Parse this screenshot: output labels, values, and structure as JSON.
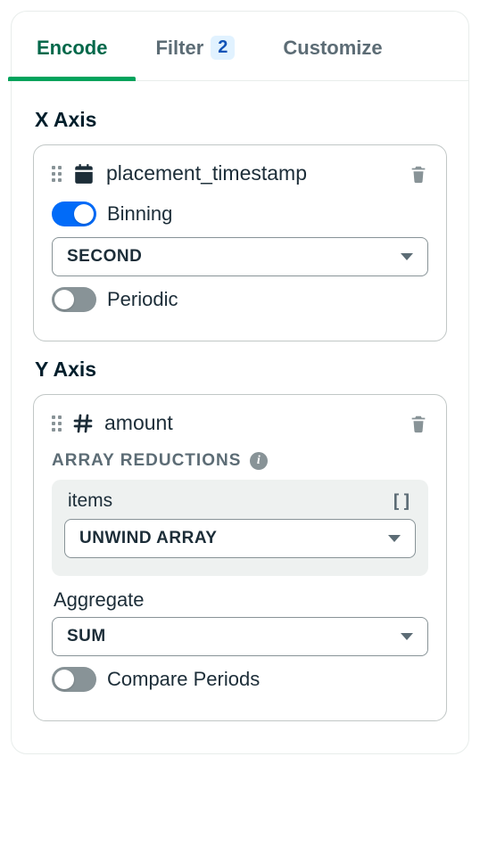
{
  "tabs": {
    "encode": "Encode",
    "filter": "Filter",
    "filter_count": "2",
    "customize": "Customize"
  },
  "xaxis": {
    "title": "X Axis",
    "field": "placement_timestamp",
    "binning_label": "Binning",
    "binning_select": "SECOND",
    "periodic_label": "Periodic"
  },
  "yaxis": {
    "title": "Y Axis",
    "field": "amount",
    "reductions_header": "ARRAY REDUCTIONS",
    "reduction_field": "items",
    "reduction_select": "UNWIND ARRAY",
    "aggregate_label": "Aggregate",
    "aggregate_select": "SUM",
    "compare_label": "Compare Periods"
  }
}
